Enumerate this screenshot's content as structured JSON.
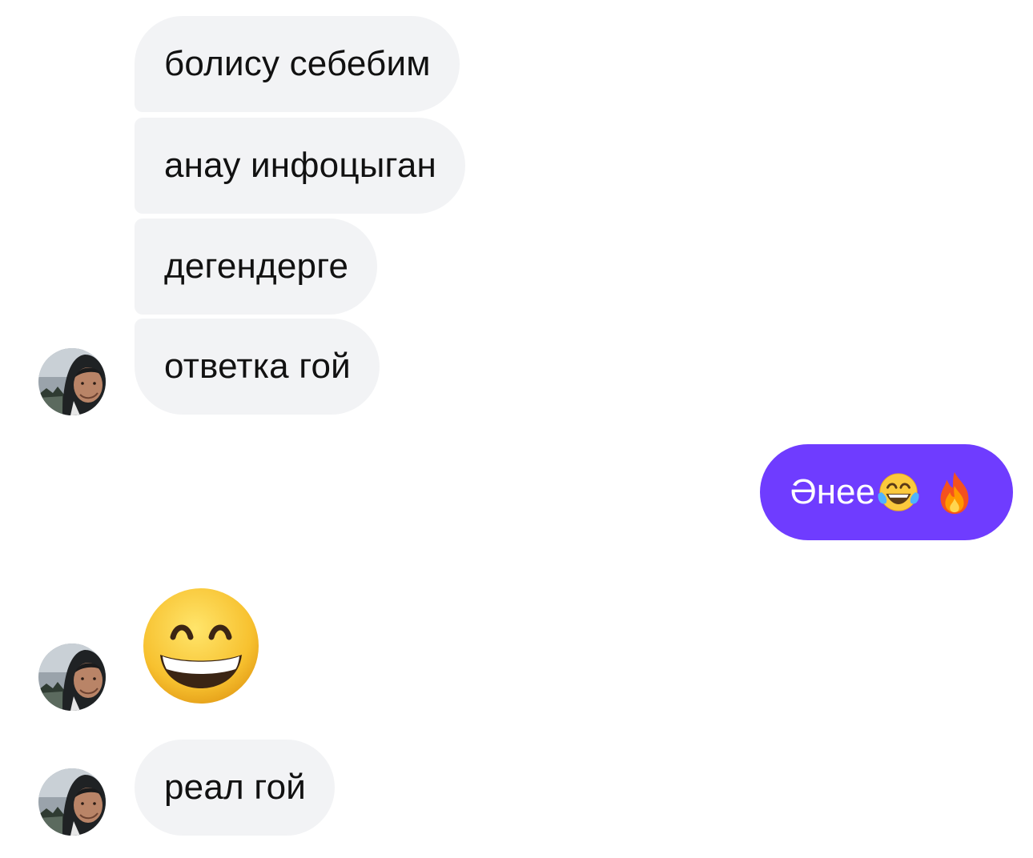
{
  "chat": {
    "messages": [
      {
        "text": "болису себебим"
      },
      {
        "text": "анау инфоцыган"
      },
      {
        "text": "дегендерге"
      },
      {
        "text": "ответка гой"
      },
      {
        "text": "Әнее",
        "emojis": [
          "face-with-tears-of-joy-icon",
          "fire-icon"
        ]
      },
      {
        "emoji": "grinning-face-with-smiling-eyes-icon"
      },
      {
        "text": "реал гой"
      }
    ]
  },
  "colors": {
    "incoming_bubble": "#f2f3f5",
    "outgoing_bubble": "#6f3cff",
    "incoming_text": "#111111",
    "outgoing_text": "#ffffff"
  }
}
